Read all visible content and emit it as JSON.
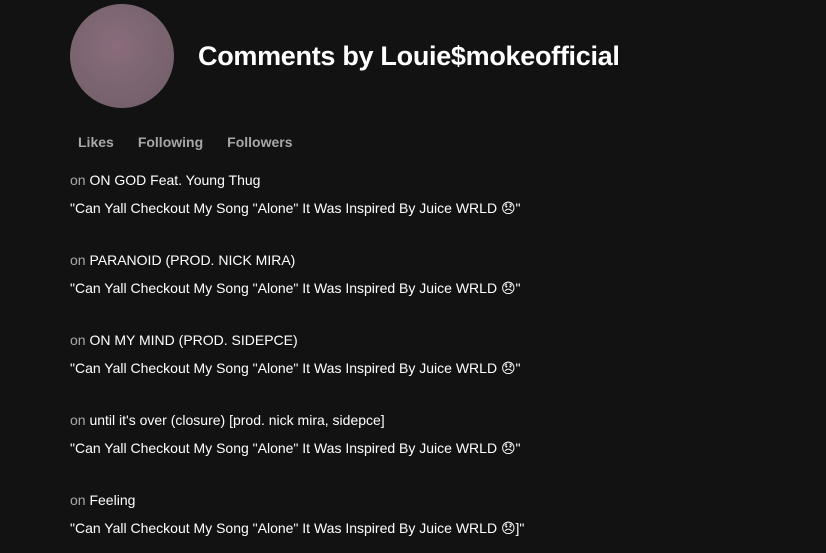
{
  "profile": {
    "title": "Comments by Louie$mokeofficial",
    "avatar_color": "#7a6470"
  },
  "tabs": [
    {
      "label": "Likes"
    },
    {
      "label": "Following"
    },
    {
      "label": "Followers"
    }
  ],
  "on_word": "on",
  "comments": [
    {
      "song": "ON GOD Feat. Young Thug",
      "text": "\"Can Yall Checkout My Song \"Alone\" It Was Inspired By Juice WRLD 😞\""
    },
    {
      "song": "PARANOID (PROD. NICK MIRA)",
      "text": "\"Can Yall Checkout My Song \"Alone\" It Was Inspired By Juice WRLD 😞\""
    },
    {
      "song": "ON MY MIND (PROD. SIDEPCE)",
      "text": "\"Can Yall Checkout My Song \"Alone\" It Was Inspired By Juice WRLD 😞\""
    },
    {
      "song": "until it's over (closure) [prod. nick mira, sidepce]",
      "text": "\"Can Yall Checkout My Song \"Alone\" It Was Inspired By Juice WRLD 😞\""
    },
    {
      "song": "Feeling",
      "text": "\"Can Yall Checkout My Song \"Alone\" It Was Inspired By Juice WRLD 😞]\""
    }
  ]
}
